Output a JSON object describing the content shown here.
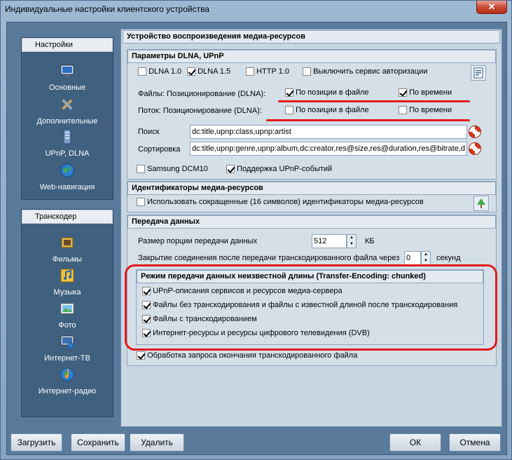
{
  "window": {
    "title": "Индивидуальные настройки клиентского устройства",
    "close_label": "✕"
  },
  "sidebar": {
    "settings_header": "Настройки",
    "settings_items": [
      {
        "label": "Основные",
        "icon": "monitor-icon"
      },
      {
        "label": "Дополнительные",
        "icon": "tools-icon"
      },
      {
        "label": "UPnP, DLNA",
        "icon": "server-icon"
      },
      {
        "label": "Web-навигация",
        "icon": "globe-icon"
      }
    ],
    "transcoder_header": "Транскодер",
    "transcoder_items": [
      {
        "label": "Фильмы",
        "icon": "film-icon"
      },
      {
        "label": "Музыка",
        "icon": "music-icon"
      },
      {
        "label": "Фото",
        "icon": "photo-icon"
      },
      {
        "label": "Интернет-ТВ",
        "icon": "tv-icon"
      },
      {
        "label": "Интернет-радио",
        "icon": "radio-icon"
      }
    ]
  },
  "main": {
    "title": "Устройство воспроизведения медиа-ресурсов",
    "dlna": {
      "header": "Параметры DLNA, UPnP",
      "dlna10": {
        "label": "DLNA 1.0",
        "checked": false
      },
      "dlna15": {
        "label": "DLNA 1.5",
        "checked": true
      },
      "http10": {
        "label": "HTTP 1.0",
        "checked": false
      },
      "disable_auth": {
        "label": "Выключить сервис авторизации",
        "checked": false
      },
      "files_label": "Файлы: Позиционирование (DLNA):",
      "files_pos": {
        "label": "По позиции в файле",
        "checked": true
      },
      "files_time": {
        "label": "По времени",
        "checked": true
      },
      "stream_label": "Поток: Позиционирование (DLNA):",
      "stream_pos": {
        "label": "По позиции в файле",
        "checked": false
      },
      "stream_time": {
        "label": "По времени",
        "checked": false
      },
      "search_label": "Поиск",
      "search_value": "dc:title,upnp:class,upnp:artist",
      "sort_label": "Сортировка",
      "sort_value": "dc:title,upnp:genre,upnp:album,dc:creator,res@size,res@duration,res@bitrate,d",
      "samsung": {
        "label": "Samsung DCM10",
        "checked": false
      },
      "upnp_events": {
        "label": "Поддержка UPnP-событий",
        "checked": true
      }
    },
    "ids": {
      "header": "Идентификаторы медиа-ресурсов",
      "short_ids": {
        "label": "Использовать сокращенные (16 символов) идентификаторы медиа-ресурсов",
        "checked": false
      }
    },
    "transfer": {
      "header": "Передача данных",
      "chunk_label": "Размер порции передачи данных",
      "chunk_value": "512",
      "chunk_unit": "КБ",
      "close_label": "Закрытие соединения после передачи транскодированного файла через",
      "close_value": "0",
      "close_unit": "секунд",
      "chunked_header": "Режим передачи данных неизвестной длины (Transfer-Encoding: chunked)",
      "chunked_items": [
        {
          "label": "UPnP-описания сервисов и ресурсов медиа-сервера",
          "checked": true
        },
        {
          "label": "Файлы без транскодирования и файлы с известной длиной после транскодирования",
          "checked": true
        },
        {
          "label": "Файлы с транскодированием",
          "checked": true
        },
        {
          "label": "Интернет-ресурсы и ресурсы цифрового телевидения (DVB)",
          "checked": true
        }
      ],
      "end_request": {
        "label": "Обработка запроса окончания транскодированного файла",
        "checked": true
      }
    }
  },
  "buttons": {
    "load": "Загрузить",
    "save": "Сохранить",
    "delete": "Удалить",
    "ok": "ОК",
    "cancel": "Отмена"
  },
  "colors": {
    "annotation_red": "#e21b1b",
    "window_blue": "#8fa9c4"
  }
}
